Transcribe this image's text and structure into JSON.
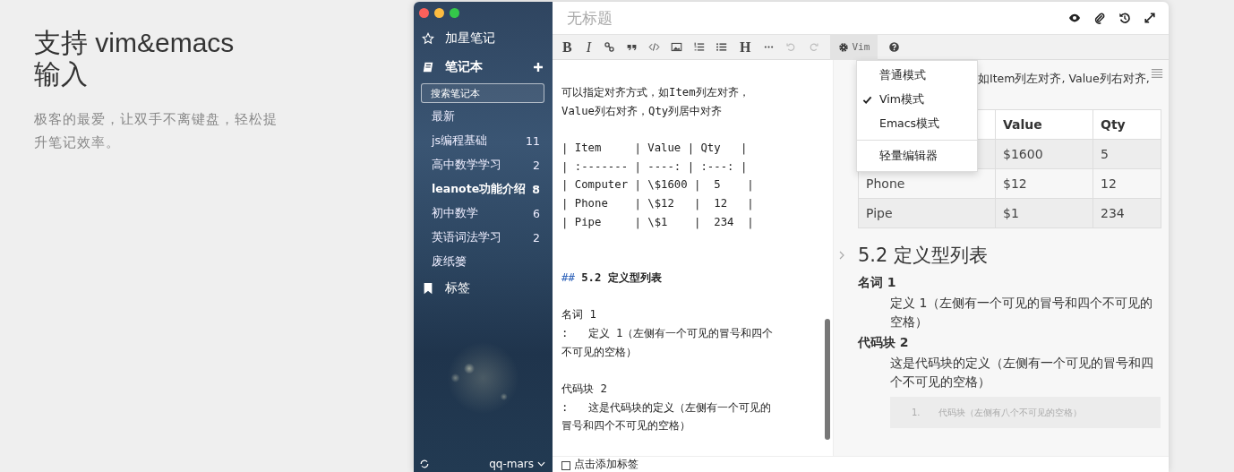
{
  "intro": {
    "title": "支持 vim&emacs输入",
    "description": "极客的最爱，让双手不离键盘，轻松提升笔记效率。"
  },
  "sidebar": {
    "starred": "加星笔记",
    "notebooks": "笔记本",
    "search": {
      "placeholder": "搜索笔记本"
    },
    "items": [
      {
        "label": "最新",
        "selected": false
      },
      {
        "label": "js编程基础",
        "count": "11",
        "selected": false
      },
      {
        "label": "高中数学学习",
        "count": "2",
        "selected": false
      },
      {
        "label": "leanote功能介绍",
        "count": "8",
        "selected": true
      },
      {
        "label": "初中数学",
        "count": "6",
        "selected": false
      },
      {
        "label": "英语词法学习",
        "count": "2",
        "selected": false
      },
      {
        "label": "废纸篓",
        "selected": false
      }
    ],
    "tags": "标签",
    "user": "qq-mars"
  },
  "editor": {
    "title": {
      "placeholder": "无标题"
    },
    "toolbar": [
      {
        "kind": "bold",
        "label": "B",
        "disabled": false
      },
      {
        "kind": "italic",
        "label": "I",
        "disabled": false
      },
      {
        "kind": "link",
        "disabled": false
      },
      {
        "kind": "quote",
        "disabled": false
      },
      {
        "kind": "code",
        "disabled": false
      },
      {
        "kind": "image",
        "disabled": false
      },
      {
        "kind": "ordered-list",
        "disabled": false
      },
      {
        "kind": "bullet-list",
        "disabled": false
      },
      {
        "kind": "heading",
        "label": "H",
        "disabled": false
      },
      {
        "kind": "more",
        "disabled": false
      },
      {
        "kind": "undo",
        "disabled": true
      },
      {
        "kind": "redo",
        "disabled": true
      },
      {
        "kind": "mode",
        "label": "Vim",
        "disabled": false,
        "expanded": true
      },
      {
        "kind": "help",
        "disabled": false
      }
    ],
    "mode_menu": {
      "modes": [
        {
          "label": "普通模式",
          "selected": false
        },
        {
          "label": "Vim模式",
          "selected": true
        },
        {
          "label": "Emacs模式",
          "selected": false
        }
      ],
      "extra": "轻量编辑器"
    },
    "source_lines": [
      {
        "kind": "text",
        "text": "可以指定对齐方式，如Item列左对齐，"
      },
      {
        "kind": "text",
        "text": "Value列右对齐，Qty列居中对齐"
      },
      {
        "kind": "blank"
      },
      {
        "kind": "text",
        "text": "| Item     | Value | Qty   |"
      },
      {
        "kind": "text",
        "text": "| :------- | ----: | :---: |"
      },
      {
        "kind": "text",
        "text": "| Computer | \\$1600 |  5    |"
      },
      {
        "kind": "text",
        "text": "| Phone    | \\$12   |  12   |"
      },
      {
        "kind": "text",
        "text": "| Pipe     | \\$1    |  234  |"
      },
      {
        "kind": "blank"
      },
      {
        "kind": "blank"
      },
      {
        "kind": "heading",
        "marker": "##",
        "text": "5.2 定义型列表"
      },
      {
        "kind": "blank"
      },
      {
        "kind": "text",
        "text": "名词 1"
      },
      {
        "kind": "text",
        "text": ":   定义 1（左侧有一个可见的冒号和四个"
      },
      {
        "kind": "text",
        "text": "不可见的空格）"
      },
      {
        "kind": "blank"
      },
      {
        "kind": "text",
        "text": "代码块 2"
      },
      {
        "kind": "text",
        "text": ":   这是代码块的定义（左侧有一个可见的"
      },
      {
        "kind": "text",
        "text": "冒号和四个不可见的空格）"
      }
    ],
    "preview": {
      "intro_line": "如Item列左对齐, Value列右对齐,",
      "table": {
        "columns": [
          null,
          "Value",
          "Qty"
        ],
        "rows": [
          [
            null,
            "$1600",
            "5"
          ],
          [
            "Phone",
            "$12",
            "12"
          ],
          [
            "Pipe",
            "$1",
            "234"
          ]
        ]
      },
      "heading": "5.2 定义型列表",
      "definitions": [
        {
          "term": "名词 1",
          "definition": "定义 1（左侧有一个可见的冒号和四个不可见的空格）"
        },
        {
          "term": "代码块 2",
          "definition": "这是代码块的定义（左侧有一个可见的冒号和四个不可见的空格）",
          "code": {
            "line_number": "1.",
            "text": "代码块（左侧有八个不可见的空格）"
          }
        }
      ]
    },
    "tag_hint": "点击添加标签"
  }
}
